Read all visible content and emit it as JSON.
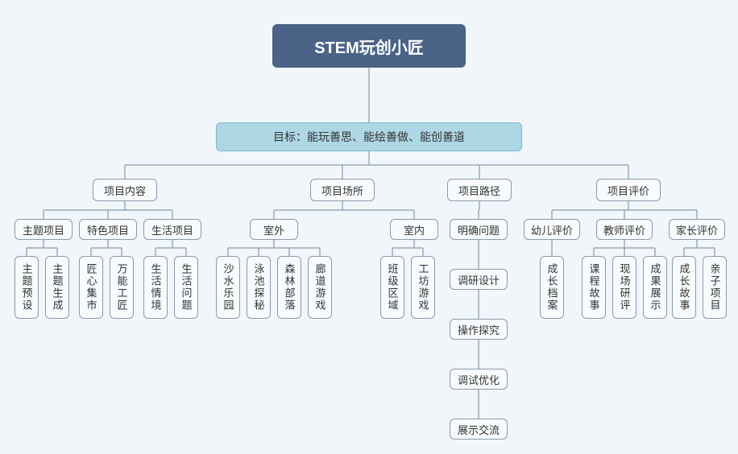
{
  "root": "STEM玩创小匠",
  "goal": "目标：能玩善思、能绘善做、能创善道",
  "l2": {
    "content": "项目内容",
    "place": "项目场所",
    "path": "项目路径",
    "eval": "项目评价"
  },
  "content": {
    "topic": "主题项目",
    "feature": "特色项目",
    "life": "生活项目",
    "topic_items": [
      "主题预设",
      "主题生成"
    ],
    "feature_items": [
      "匠心集市",
      "万能工匠"
    ],
    "life_items": [
      "生活情境",
      "生活问题"
    ]
  },
  "place": {
    "outdoor": "室外",
    "indoor": "室内",
    "outdoor_items": [
      "沙水乐园",
      "泳池探秘",
      "森林部落",
      "廊道游戏"
    ],
    "indoor_items": [
      "班级区域",
      "工坊游戏"
    ]
  },
  "path": {
    "steps": [
      "明确问题",
      "调研设计",
      "操作探究",
      "调试优化",
      "展示交流"
    ]
  },
  "eval": {
    "child": "幼儿评价",
    "teacher": "教师评价",
    "parent": "家长评价",
    "child_items": [
      "成长档案"
    ],
    "teacher_items": [
      "课程故事",
      "现场研评",
      "成果展示"
    ],
    "parent_items": [
      "成长故事",
      "亲子项目"
    ]
  },
  "chart_data": {
    "type": "tree",
    "title": "STEM玩创小匠",
    "root": {
      "name": "STEM玩创小匠",
      "children": [
        {
          "name": "目标：能玩善思、能绘善做、能创善道",
          "children": [
            {
              "name": "项目内容",
              "children": [
                {
                  "name": "主题项目",
                  "children": [
                    {
                      "name": "主题预设"
                    },
                    {
                      "name": "主题生成"
                    }
                  ]
                },
                {
                  "name": "特色项目",
                  "children": [
                    {
                      "name": "匠心集市"
                    },
                    {
                      "name": "万能工匠"
                    }
                  ]
                },
                {
                  "name": "生活项目",
                  "children": [
                    {
                      "name": "生活情境"
                    },
                    {
                      "name": "生活问题"
                    }
                  ]
                }
              ]
            },
            {
              "name": "项目场所",
              "children": [
                {
                  "name": "室外",
                  "children": [
                    {
                      "name": "沙水乐园"
                    },
                    {
                      "name": "泳池探秘"
                    },
                    {
                      "name": "森林部落"
                    },
                    {
                      "name": "廊道游戏"
                    }
                  ]
                },
                {
                  "name": "室内",
                  "children": [
                    {
                      "name": "班级区域"
                    },
                    {
                      "name": "工坊游戏"
                    }
                  ]
                }
              ]
            },
            {
              "name": "项目路径",
              "children": [
                {
                  "name": "明确问题",
                  "children": [
                    {
                      "name": "调研设计",
                      "children": [
                        {
                          "name": "操作探究",
                          "children": [
                            {
                              "name": "调试优化",
                              "children": [
                                {
                                  "name": "展示交流"
                                }
                              ]
                            }
                          ]
                        }
                      ]
                    }
                  ]
                }
              ]
            },
            {
              "name": "项目评价",
              "children": [
                {
                  "name": "幼儿评价",
                  "children": [
                    {
                      "name": "成长档案"
                    }
                  ]
                },
                {
                  "name": "教师评价",
                  "children": [
                    {
                      "name": "课程故事"
                    },
                    {
                      "name": "现场研评"
                    },
                    {
                      "name": "成果展示"
                    }
                  ]
                },
                {
                  "name": "家长评价",
                  "children": [
                    {
                      "name": "成长故事"
                    },
                    {
                      "name": "亲子项目"
                    }
                  ]
                }
              ]
            }
          ]
        }
      ]
    }
  }
}
